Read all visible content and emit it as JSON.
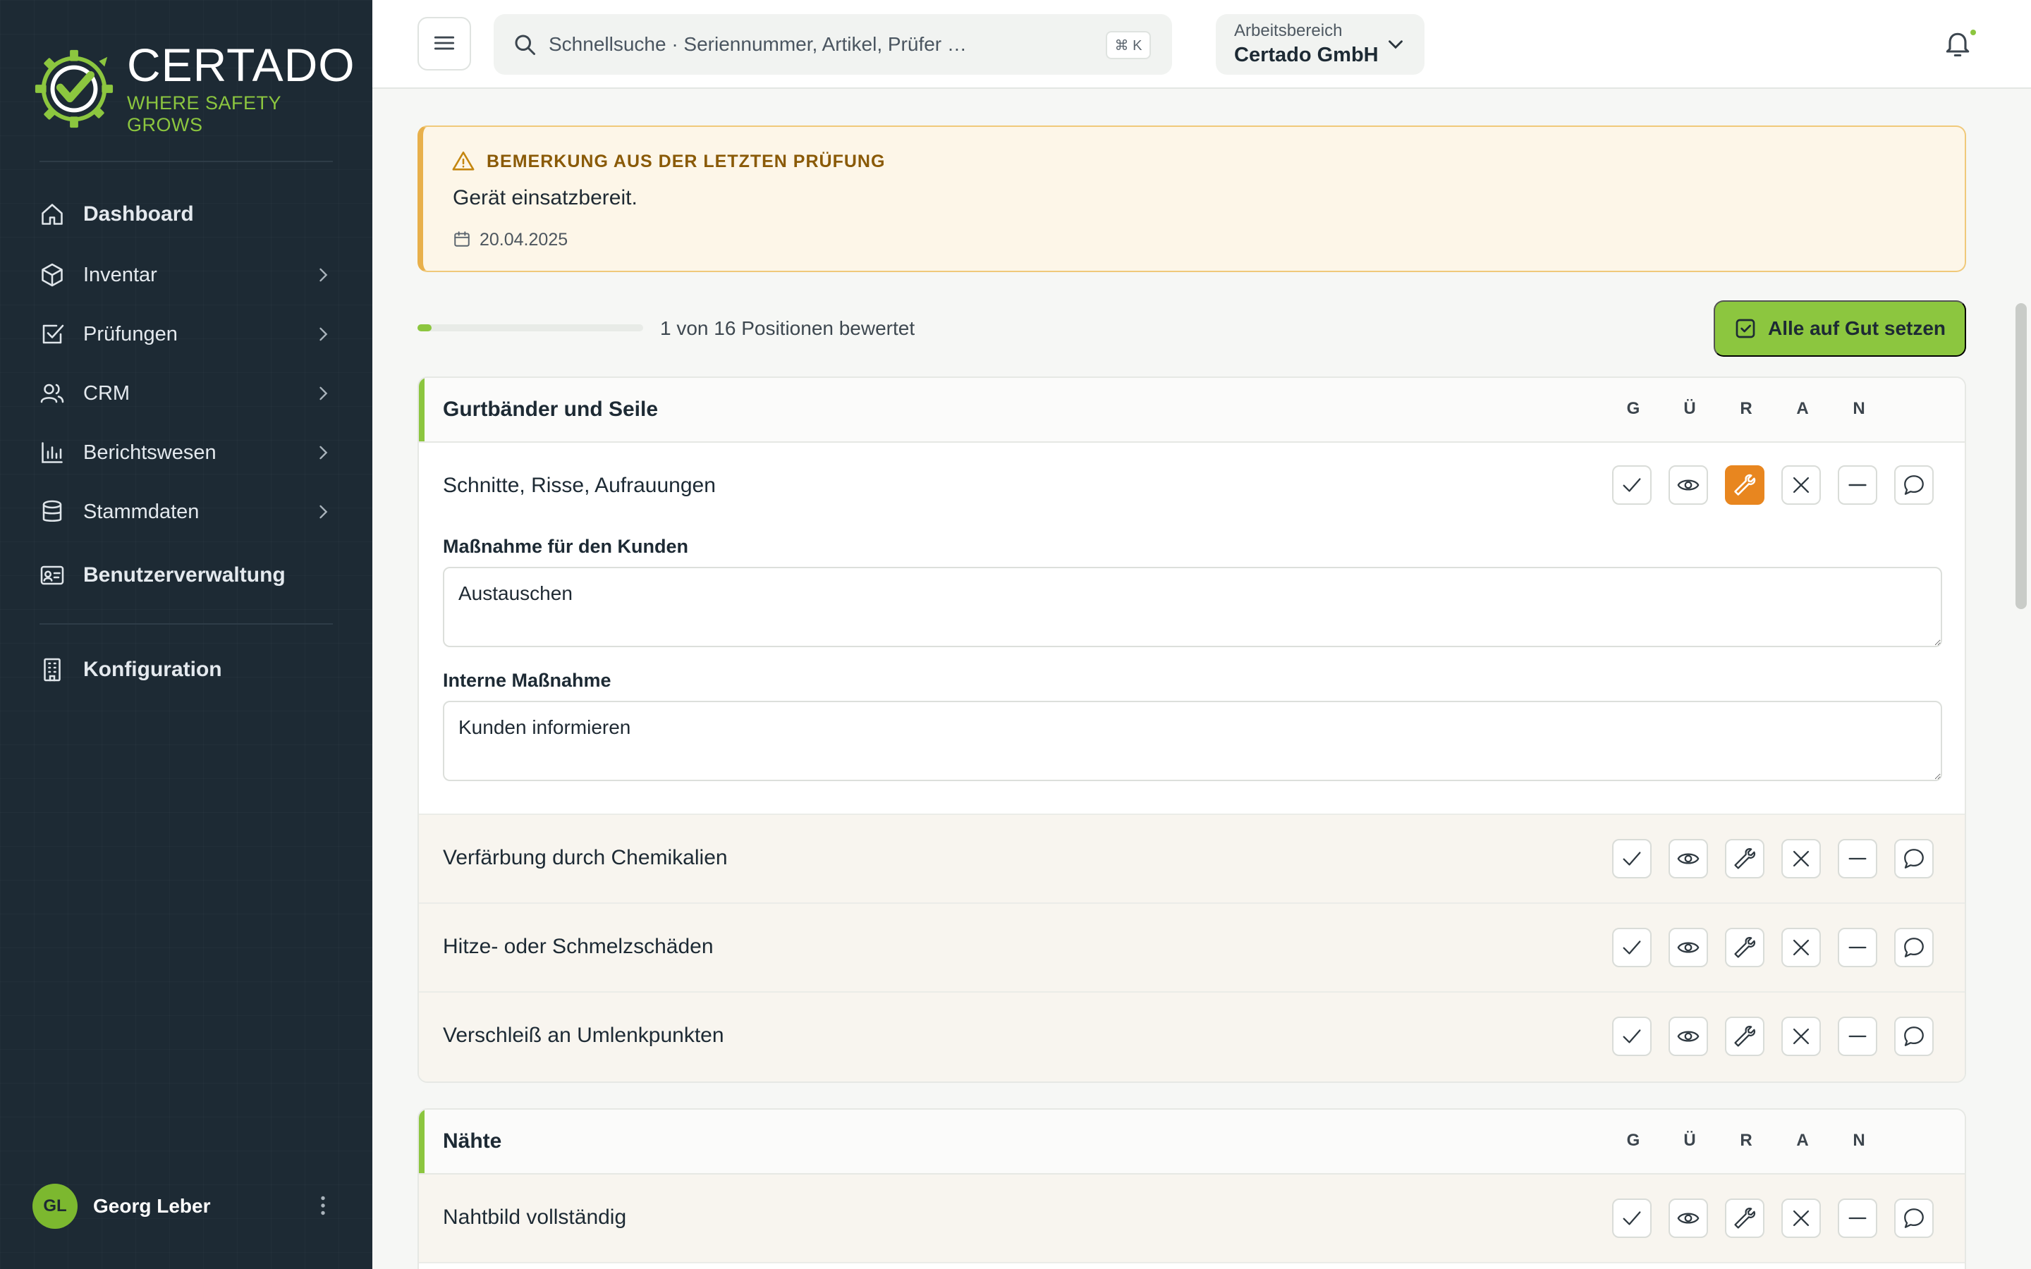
{
  "brand": {
    "name": "CERTADO",
    "tagline": "WHERE SAFETY GROWS",
    "accent": "#8cc63f",
    "sidebar_bg": "#1d2a34"
  },
  "sidebar": {
    "items": [
      {
        "label": "Dashboard",
        "icon": "home-icon",
        "submenu": false
      },
      {
        "label": "Inventar",
        "icon": "box-icon",
        "submenu": true
      },
      {
        "label": "Prüfungen",
        "icon": "checkbox-icon",
        "submenu": true
      },
      {
        "label": "CRM",
        "icon": "users-icon",
        "submenu": true
      },
      {
        "label": "Berichtswesen",
        "icon": "bar-chart-icon",
        "submenu": true
      },
      {
        "label": "Stammdaten",
        "icon": "database-icon",
        "submenu": true
      },
      {
        "label": "Benutzerverwaltung",
        "icon": "id-card-icon",
        "submenu": false
      },
      {
        "label": "Konfiguration",
        "icon": "building-icon",
        "submenu": false
      }
    ],
    "user": {
      "initials": "GL",
      "name": "Georg Leber"
    }
  },
  "header": {
    "search_placeholder": "Schnellsuche · Seriennummer, Artikel, Prüfer …",
    "search_shortcut": "⌘ K",
    "workspace_label": "Arbeitsbereich",
    "workspace_value": "Certado GmbH"
  },
  "alert": {
    "title": "BEMERKUNG AUS DER LETZTEN PRÜFUNG",
    "text": "Gerät einsatzbereit.",
    "date": "20.04.2025",
    "color": "#e8b04b"
  },
  "progress": {
    "text": "1 von 16 Positionen bewertet",
    "rated": 1,
    "total": 16
  },
  "actions": {
    "all_good_label": "Alle auf Gut setzen"
  },
  "rating_columns": [
    "G",
    "Ü",
    "R",
    "A",
    "N"
  ],
  "rating_buttons": [
    "check-icon",
    "eye-icon",
    "wrench-icon",
    "x-icon",
    "minus-icon",
    "comment-icon"
  ],
  "sections": [
    {
      "title": "Gurtbänder und Seile",
      "rows": [
        {
          "label": "Schnitte, Risse, Aufrauungen",
          "selected": "R",
          "customer_measure_label": "Maßnahme für den Kunden",
          "customer_measure_value": "Austauschen",
          "internal_measure_label": "Interne Maßnahme",
          "internal_measure_value": "Kunden informieren"
        },
        {
          "label": "Verfärbung durch Chemikalien",
          "selected": null
        },
        {
          "label": "Hitze- oder Schmelzschäden",
          "selected": null
        },
        {
          "label": "Verschleiß an Umlenkpunkten",
          "selected": null
        }
      ]
    },
    {
      "title": "Nähte",
      "rows": [
        {
          "label": "Nahtbild vollständig",
          "selected": null
        }
      ]
    }
  ],
  "status_colors": {
    "repair_active": "#e8861f"
  }
}
